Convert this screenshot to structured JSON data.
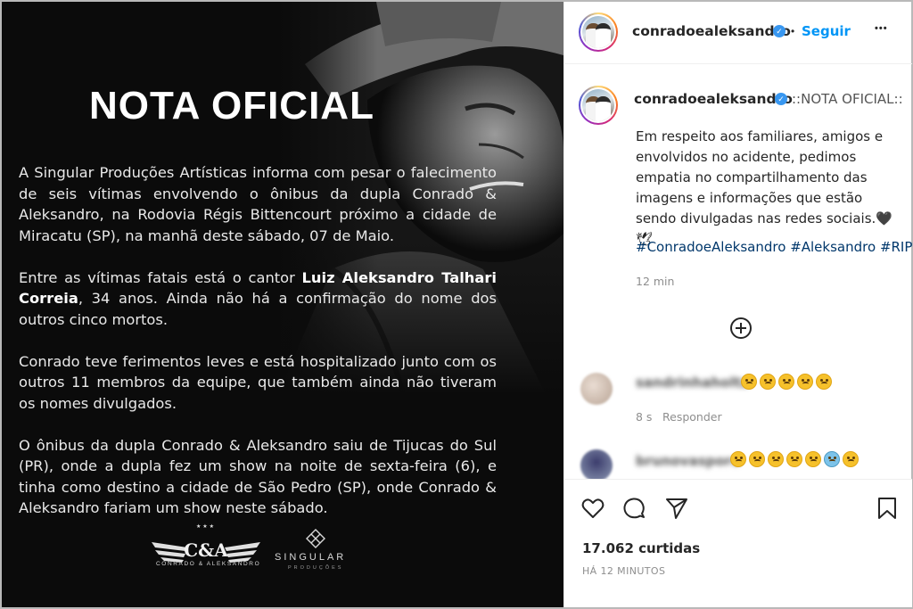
{
  "post": {
    "title": "NOTA OFICIAL",
    "paragraphs": [
      {
        "text": "A Singular Produções Artísticas informa com pesar o falecimento de seis vítimas envolvendo o ônibus da dupla Conrado & Aleksandro, na Rodovia Régis Bittencourt próximo a cidade de Miracatu (SP), na manhã deste sábado, 07 de Maio."
      },
      {
        "before": "Entre as vítimas fatais está o cantor ",
        "bold": "Luiz Aleksandro Talhari Correia",
        "after": ", 34 anos. Ainda não há  a confirmação do nome dos outros cinco mortos."
      },
      {
        "text": "Conrado teve ferimentos leves e está hospitalizado junto com os outros 11 membros da equipe, que também ainda não tiveram os nomes divulgados."
      },
      {
        "text": "O ônibus da dupla Conrado & Aleksandro saiu de Tijucas do Sul (PR), onde a dupla fez um show na noite de sexta-feira (6), e tinha como destino a cidade de São Pedro (SP), onde Conrado & Aleksandro fariam um show neste sábado."
      }
    ],
    "logo_ca": "C&A",
    "logo_ca_caption": "CONRADO & ALEKSANDRO",
    "logo_singular": "SINGULAR",
    "logo_singular_caption": "PRODUÇÕES"
  },
  "header": {
    "username": "conradoealeksandro",
    "dot": "•",
    "follow_label": "Seguir",
    "more_label": "•••"
  },
  "caption": {
    "username": "conradoealeksandro",
    "intro": "::NOTA OFICIAL::",
    "body": "Em respeito aos familiares, amigos e envolvidos no acidente, pedimos empatia no compartilhamento das imagens e informações que estão sendo divulgadas nas redes sociais.🖤🕊",
    "hashtags": [
      "#ConradoeAleksandro",
      "#Aleksandro",
      "#RIP"
    ],
    "time": "12 min"
  },
  "comments": [
    {
      "username": "sandrinhaholtz",
      "time": "8 s",
      "reply_label": "Responder",
      "emoji_count": 5
    },
    {
      "username": "brunovasporo",
      "emoji_count": 7
    }
  ],
  "actions": {
    "icons": [
      "heart-icon",
      "comment-icon",
      "share-icon",
      "bookmark-icon"
    ],
    "likes": "17.062 curtidas",
    "posted": "HÁ 12 MINUTOS"
  },
  "colors": {
    "link": "#0095f6",
    "hashtag": "#00376b",
    "verified": "#3897f0",
    "post_bg": "#0b0b0b"
  }
}
